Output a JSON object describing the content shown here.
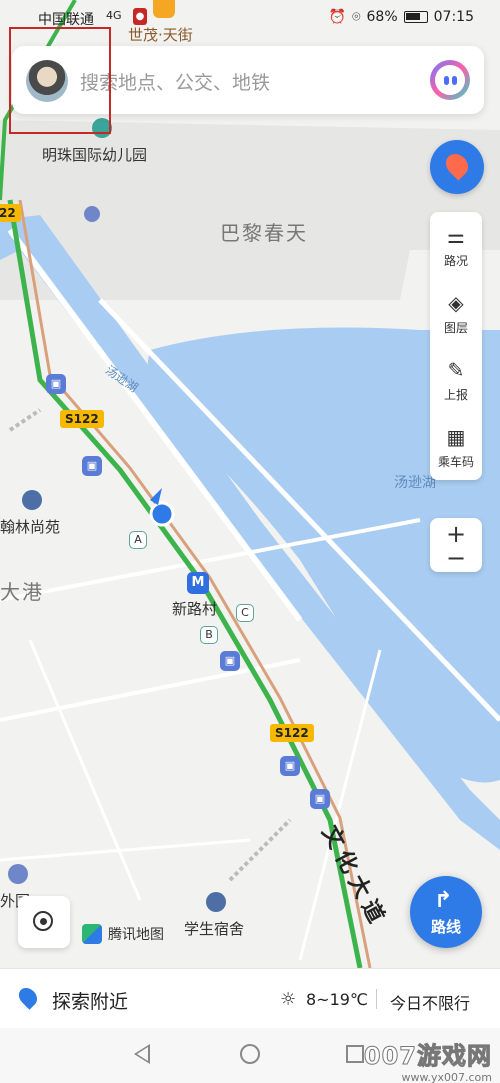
{
  "status_bar": {
    "carrier": "中国联通",
    "signal": "4G",
    "battery": "68%",
    "time": "07:15"
  },
  "search": {
    "placeholder": "搜索地点、公交、地铁"
  },
  "map": {
    "labels": {
      "shimao": "世茂·天街",
      "kindergarten": "明珠国际幼儿园",
      "paris": "巴黎春天",
      "hanlin": "翰林尚苑",
      "dagang": "大港",
      "xinlucun": "新路村",
      "dorm": "学生宿舍",
      "lake": "汤逊湖",
      "river": "汤逊湖",
      "road": "文化大道",
      "outer": "外国"
    },
    "road_shields": [
      "S122",
      "S122"
    ],
    "exits": [
      "A",
      "B",
      "C"
    ],
    "metro_symbol": "M",
    "badge_left": "22"
  },
  "tools": [
    {
      "label": "路况",
      "icon": "traffic-icon"
    },
    {
      "label": "图层",
      "icon": "layers-icon"
    },
    {
      "label": "上报",
      "icon": "report-icon"
    },
    {
      "label": "乘车码",
      "icon": "qrcode-icon"
    }
  ],
  "zoom": {
    "plus": "+",
    "minus": "−"
  },
  "logo": "腾讯地图",
  "route_button": "路线",
  "bottom": {
    "explore": "探索附近",
    "weather": "8~19℃",
    "limit": "今日不限行"
  },
  "watermark": {
    "main": "007游戏网",
    "url": "www.yx007.com"
  }
}
